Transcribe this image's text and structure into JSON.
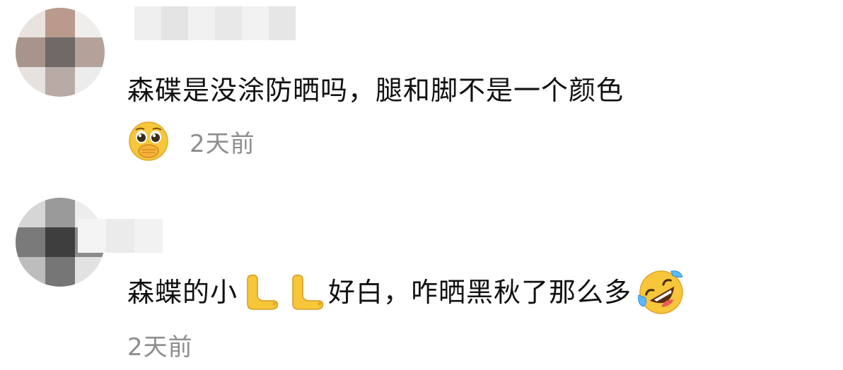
{
  "comments": [
    {
      "text_parts": [
        "森碟是没涂防晒吗，腿和脚不是一个颜色"
      ],
      "reaction_icon": "pleading-face-hands-over-mouth-emoji",
      "timestamp": "2天前"
    },
    {
      "text_before": "森蝶的小",
      "inline_icons": [
        "foot-emoji",
        "foot-emoji"
      ],
      "text_after": "好白，咋晒黑秋了那么多",
      "trailing_icon": "rolling-on-floor-laughing-emoji",
      "timestamp": "2天前"
    }
  ],
  "colors": {
    "text": "#111111",
    "timestamp": "#8e8e8e",
    "background": "#ffffff",
    "emoji_yellow": "#f7c63a"
  }
}
